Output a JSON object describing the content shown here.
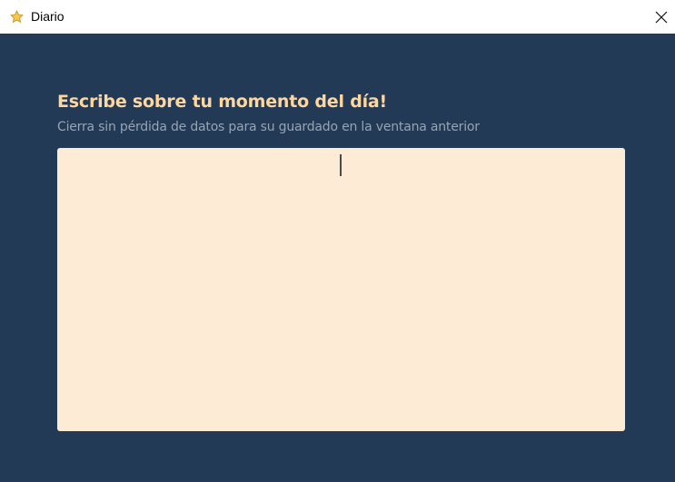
{
  "window": {
    "title": "Diario",
    "icon": "star-icon",
    "close_icon": "close-icon"
  },
  "main": {
    "heading": "Escribe sobre tu momento del día!",
    "subtitle": "Cierra sin pérdida de datos para su guardado en la ventana anterior",
    "editor_value": ""
  },
  "colors": {
    "background": "#233a56",
    "heading": "#ffd79e",
    "subtitle": "#97a4b3",
    "editor_background": "#fdebd6",
    "titlebar": "#ffffff"
  }
}
